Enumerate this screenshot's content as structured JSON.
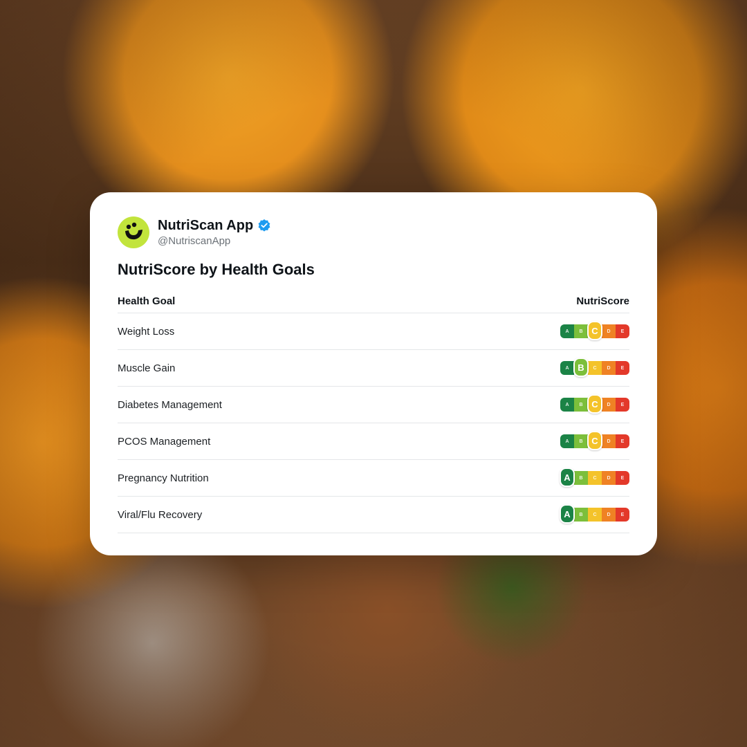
{
  "profile": {
    "name": "NutriScan App",
    "handle": "@NutriscanApp",
    "avatar_icon": "nutriscan-logo-icon",
    "verified_icon": "verified-badge-icon",
    "avatar_color": "#c2e43c",
    "verified_color": "#1d9bf0"
  },
  "title": "NutriScore by Health Goals",
  "table": {
    "headers": {
      "goal": "Health Goal",
      "score": "NutriScore"
    },
    "scale_letters": [
      "A",
      "B",
      "C",
      "D",
      "E"
    ],
    "scale_colors": [
      "#1b8346",
      "#7cbf3b",
      "#f4c32a",
      "#ef8224",
      "#e3392a"
    ],
    "rows": [
      {
        "goal": "Weight Loss",
        "score": "C"
      },
      {
        "goal": "Muscle Gain",
        "score": "B"
      },
      {
        "goal": "Diabetes Management",
        "score": "C"
      },
      {
        "goal": "PCOS Management",
        "score": "C"
      },
      {
        "goal": "Pregnancy Nutrition",
        "score": "A"
      },
      {
        "goal": "Viral/Flu Recovery",
        "score": "A"
      }
    ]
  }
}
